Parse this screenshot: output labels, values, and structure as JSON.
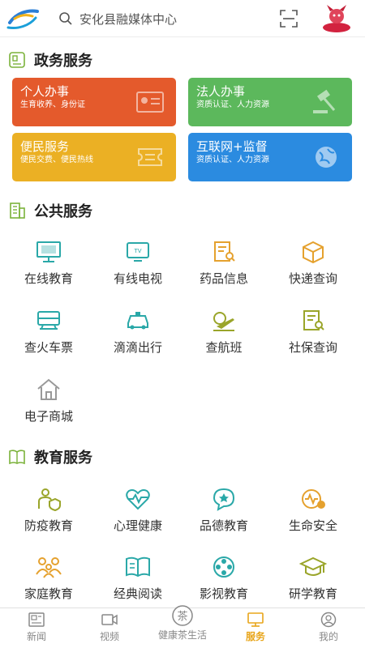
{
  "header": {
    "search_placeholder": "安化县融媒体中心"
  },
  "sections": {
    "gov": {
      "title": "政务服务"
    },
    "public": {
      "title": "公共服务"
    },
    "edu": {
      "title": "教育服务"
    }
  },
  "gov_cards": [
    {
      "title": "个人办事",
      "subtitle": "生育收养、身份证",
      "color": "#e45a2c",
      "icon": "id-card-icon"
    },
    {
      "title": "法人办事",
      "subtitle": "资质认证、人力资源",
      "color": "#5cb85c",
      "icon": "gavel-icon"
    },
    {
      "title": "便民服务",
      "subtitle": "便民交费、便民热线",
      "color": "#ebb024",
      "icon": "ticket-icon"
    },
    {
      "title": "互联网+监督",
      "subtitle": "资质认证、人力资源",
      "color": "#2b8be0",
      "icon": "globe-icon"
    }
  ],
  "public_services": [
    {
      "label": "在线教育",
      "icon": "monitor-icon"
    },
    {
      "label": "有线电视",
      "icon": "tv-icon"
    },
    {
      "label": "药品信息",
      "icon": "medicine-search-icon"
    },
    {
      "label": "快递查询",
      "icon": "package-icon"
    },
    {
      "label": "查火车票",
      "icon": "train-icon"
    },
    {
      "label": "滴滴出行",
      "icon": "taxi-icon"
    },
    {
      "label": "查航班",
      "icon": "airplane-icon"
    },
    {
      "label": "社保查询",
      "icon": "document-search-icon"
    },
    {
      "label": "电子商城",
      "icon": "home-icon"
    }
  ],
  "education_services": [
    {
      "label": "防疫教育",
      "icon": "shield-person-icon"
    },
    {
      "label": "心理健康",
      "icon": "heartbeat-icon"
    },
    {
      "label": "品德教育",
      "icon": "star-bubble-icon"
    },
    {
      "label": "生命安全",
      "icon": "life-eye-icon"
    },
    {
      "label": "家庭教育",
      "icon": "family-icon"
    },
    {
      "label": "经典阅读",
      "icon": "book-icon"
    },
    {
      "label": "影视教育",
      "icon": "film-reel-icon"
    },
    {
      "label": "研学教育",
      "icon": "graduation-cap-icon"
    }
  ],
  "bottom_nav": [
    {
      "label": "新闻",
      "icon": "news-icon",
      "active": false
    },
    {
      "label": "视频",
      "icon": "video-icon",
      "active": false
    },
    {
      "label": "健康茶生活",
      "icon": "tea-icon",
      "active": false
    },
    {
      "label": "服务",
      "icon": "service-icon",
      "active": true
    },
    {
      "label": "我的",
      "icon": "profile-icon",
      "active": false
    }
  ],
  "colors": {
    "icon_teal": "#2aa8a8",
    "icon_olive": "#9aa52a",
    "icon_orange": "#e5a12e",
    "active_nav": "#e8a51a"
  }
}
